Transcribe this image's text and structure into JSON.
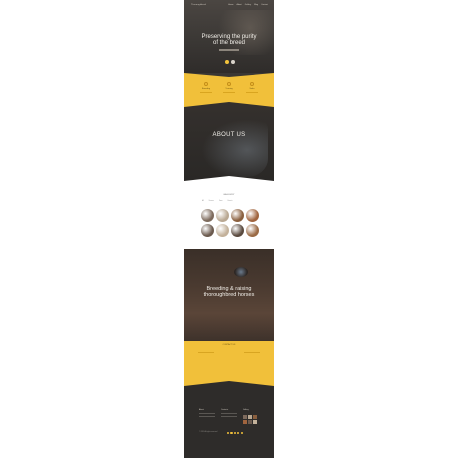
{
  "hero": {
    "logo": "Thoroughbred",
    "nav": [
      "Home",
      "About",
      "Gallery",
      "Blog",
      "Contact"
    ],
    "title_line1": "Preserving the purity",
    "title_line2": "of the breed"
  },
  "features": {
    "items": [
      {
        "label": "Breeding"
      },
      {
        "label": "Training"
      },
      {
        "label": "Sales"
      }
    ]
  },
  "about": {
    "title": "ABOUT US"
  },
  "gallery": {
    "title": "GALLERY",
    "filters": [
      "All",
      "Horses",
      "Farm",
      "Events"
    ],
    "thumb_colors": [
      "#7d6a5c",
      "#b9a892",
      "#8a5f3e",
      "#a0643e",
      "#6b5a4e",
      "#c3b19a",
      "#5a4a3f",
      "#9a6a45"
    ]
  },
  "breeding": {
    "title_line1": "Breeding & raising",
    "title_line2": "thoroughbred horses"
  },
  "contact": {
    "title": "CONTACT US"
  },
  "footer": {
    "col1_heading": "About",
    "col2_heading": "Contacts",
    "col3_heading": "Gallery",
    "copyright": "© 2015 All rights reserved"
  },
  "colors": {
    "accent": "#f1c03a",
    "dark": "#2e2c2a"
  }
}
